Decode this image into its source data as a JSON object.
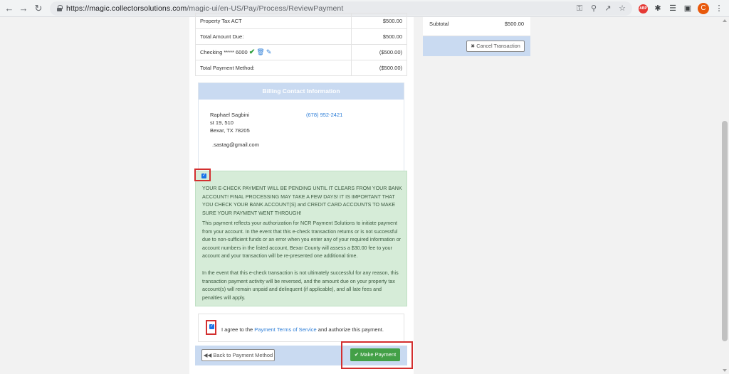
{
  "browser": {
    "url_host": "https://magic.collectorsolutions.com",
    "url_path": "/magic-ui/en-US/Pay/Process/ReviewPayment",
    "profile_initial": "C",
    "adblock_label": "ABP"
  },
  "payment_table": {
    "rows": [
      {
        "label": "Property Tax ACT",
        "amount": "$500.00"
      },
      {
        "label": "Total Amount Due:",
        "amount": "$500.00"
      },
      {
        "label": "Checking ***** 6000",
        "amount": "($500.00)"
      },
      {
        "label": "Total Payment Method:",
        "amount": "($500.00)"
      }
    ]
  },
  "billing": {
    "header": "Billing Contact Information",
    "name": "Raphael Sagbini",
    "address1": "st 19, 510",
    "address2": "Bexar, TX 78205",
    "phone": "(678) 952-2421",
    "email": ".sastag@gmail.com"
  },
  "notice": {
    "warning": "YOUR E-CHECK PAYMENT WILL BE PENDING UNTIL IT CLEARS FROM YOUR BANK ACCOUNT! FINAL PROCESSING MAY TAKE A FEW DAYS! IT IS IMPORTANT THAT YOU CHECK YOUR BANK ACCOUNT(S) and CREDIT CARD ACCOUNTS TO MAKE SURE YOUR PAYMENT WENT THROUGH!",
    "authorization": "This payment reflects your authorization for NCR Payment Solutions to initiate payment from your account. In the event that this e-check transaction returns or is not successful due to non-sufficient funds or an error when you enter any of your required information or account numbers in the listed account, Bexar County will assess a $30.00 fee to your account and your transaction will be re-presented one additional time.",
    "reversal": "In the event that this e-check transaction is not ultimately successful for any reason, this transaction payment activity will be reversed, and the amount due on your property tax account(s) will remain unpaid and delinquent (if applicable), and all late fees and penalties will apply."
  },
  "agree": {
    "prefix": "I agree to the",
    "link": "Payment Terms of Service",
    "suffix": "and authorize this payment."
  },
  "buttons": {
    "back": "Back to Payment Method",
    "make_payment": "Make Payment",
    "cancel": "Cancel Transaction"
  },
  "summary": {
    "label": "Subtotal",
    "value": "$500.00"
  }
}
